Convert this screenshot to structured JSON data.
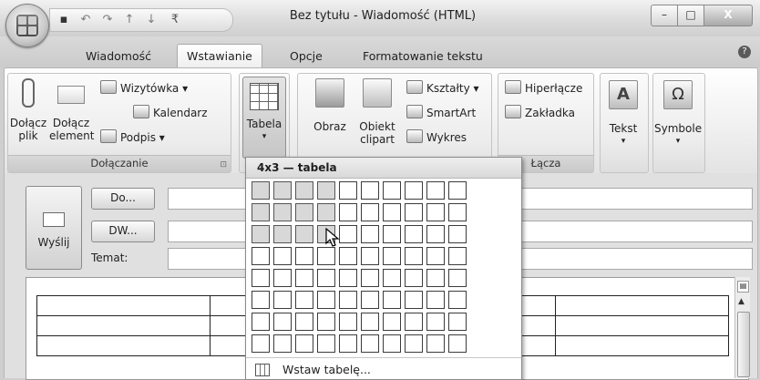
{
  "window": {
    "title": "Bez tytułu - Wiadomość (HTML)",
    "controls": {
      "minimize": "–",
      "maximize": "□",
      "close": "X"
    }
  },
  "quick_access": {
    "icons": [
      "save-icon",
      "undo-icon",
      "redo-icon",
      "up-arrow-icon",
      "down-arrow-icon"
    ],
    "more": "₹"
  },
  "tabs": [
    {
      "label": "Wiadomość",
      "active": false
    },
    {
      "label": "Wstawianie",
      "active": true
    },
    {
      "label": "Opcje",
      "active": false
    },
    {
      "label": "Formatowanie tekstu",
      "active": false
    }
  ],
  "help_label": "?",
  "ribbon": {
    "attach_group": {
      "label": "Dołączanie",
      "attach_file": {
        "line1": "Dołącz",
        "line2": "plik"
      },
      "attach_item": {
        "line1": "Dołącz",
        "line2": "element"
      },
      "business_card": "Wizytówka ▾",
      "calendar": "Kalendarz",
      "signature": "Podpis ▾"
    },
    "tables_group": {
      "table": "Tabela",
      "arrow": "▾"
    },
    "illustrations_group": {
      "picture": "Obraz",
      "clipart": {
        "line1": "Obiekt",
        "line2": "clipart"
      },
      "shapes": "Kształty ▾",
      "smartart": "SmartArt",
      "chart": "Wykres"
    },
    "links_group": {
      "label": "Łącza",
      "hyperlink": "Hiperłącze",
      "bookmark": "Zakładka"
    },
    "text_group": {
      "label": "Tekst",
      "arrow": "▾"
    },
    "symbols_group": {
      "label": "Symbole",
      "arrow": "▾",
      "icon_text": "Ω"
    }
  },
  "compose": {
    "send": "Wyślij",
    "to_button": "Do...",
    "cc_button": "DW...",
    "subject_label": "Temat:",
    "to_value": "",
    "cc_value": "",
    "subject_value": ""
  },
  "table_dropdown": {
    "header": "4x3 — tabela",
    "grid_cols": 10,
    "grid_rows": 8,
    "selected_cols": 4,
    "selected_rows": 3,
    "insert_table": "Wstaw tabelę..."
  }
}
